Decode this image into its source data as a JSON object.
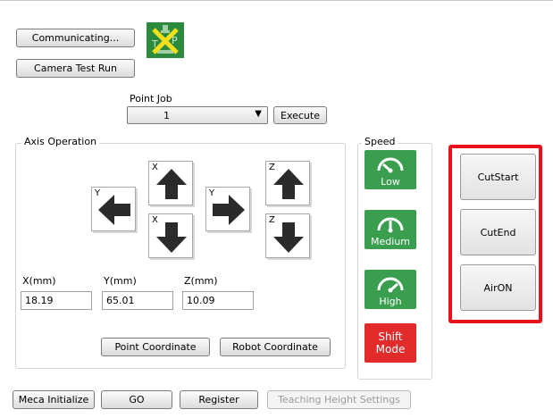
{
  "top": {
    "communicating_label": "Communicating...",
    "camera_test_label": "Camera Test Run",
    "tp_icon": "teaching-pendant-disabled-icon",
    "tp_letters": {
      "t": "T",
      "p": "P"
    }
  },
  "point_job": {
    "label": "Point Job",
    "selected": "1",
    "execute_label": "Execute"
  },
  "axis_operation": {
    "title": "Axis Operation",
    "arrows": [
      {
        "axis": "X",
        "dir": "up"
      },
      {
        "axis": "Y",
        "dir": "left"
      },
      {
        "axis": "X",
        "dir": "down"
      },
      {
        "axis": "Y",
        "dir": "right"
      },
      {
        "axis": "Z",
        "dir": "up"
      },
      {
        "axis": "Z",
        "dir": "down"
      }
    ],
    "coords": {
      "x_label": "X(mm)",
      "x_value": "18.19",
      "y_label": "Y(mm)",
      "y_value": "65.01",
      "z_label": "Z(mm)",
      "z_value": "10.09"
    },
    "point_coordinate_label": "Point Coordinate",
    "robot_coordinate_label": "Robot Coordinate"
  },
  "speed": {
    "title": "Speed",
    "low_label": "Low",
    "medium_label": "Medium",
    "high_label": "High",
    "shift_line1": "Shift",
    "shift_line2": "Mode",
    "colors": {
      "speed_green": "#3a9e4f",
      "shift_red": "#e32b2b"
    }
  },
  "cut_panel": {
    "cut_start_label": "CutStart",
    "cut_end_label": "CutEnd",
    "air_on_label": "AirON",
    "highlight_color": "#e8101c"
  },
  "bottom": {
    "meca_initialize_label": "Meca Initialize",
    "go_label": "GO",
    "register_label": "Register",
    "teaching_height_label": "Teaching Height Settings"
  }
}
